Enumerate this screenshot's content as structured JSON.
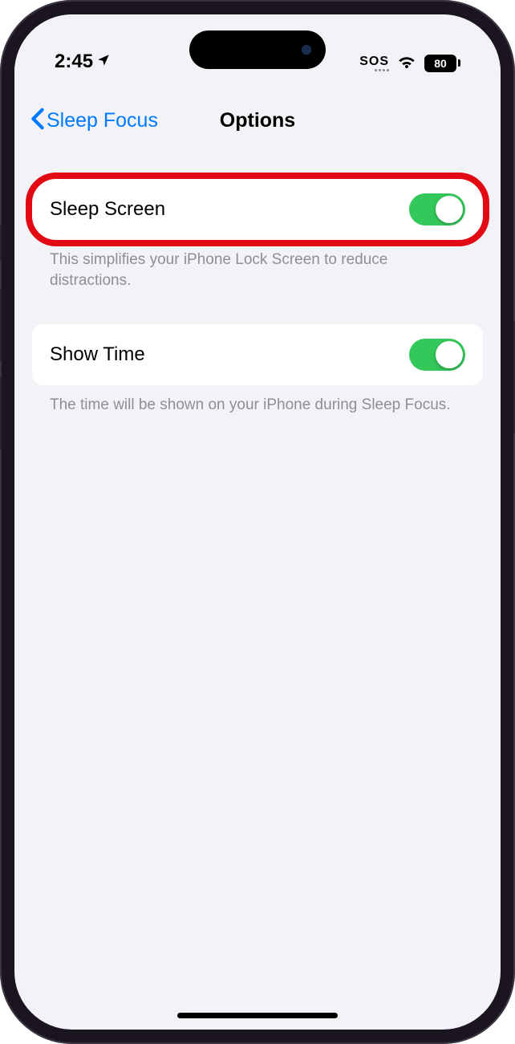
{
  "status": {
    "time": "2:45",
    "sos": "SOS",
    "battery": "80"
  },
  "nav": {
    "back_label": "Sleep Focus",
    "title": "Options"
  },
  "rows": {
    "sleep_screen": {
      "label": "Sleep Screen",
      "footer": "This simplifies your iPhone Lock Screen to reduce distractions."
    },
    "show_time": {
      "label": "Show Time",
      "footer": "The time will be shown on your iPhone during Sleep Focus."
    }
  }
}
